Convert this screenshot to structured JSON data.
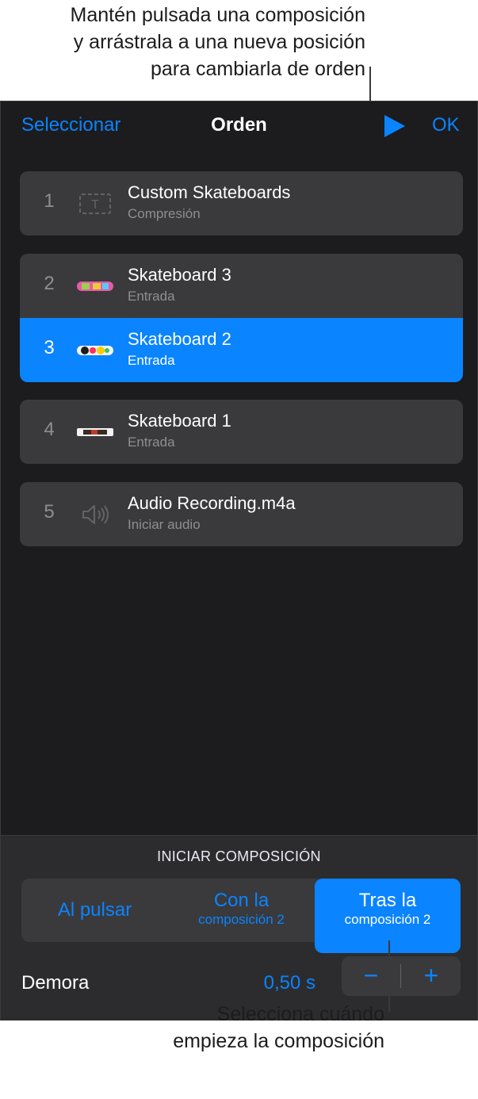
{
  "callouts": {
    "top": "Mantén pulsada una composición\ny arrástrala a una nueva posición\npara cambiarla de orden",
    "bottom": "Selecciona cuándo\nempieza la composición"
  },
  "nav": {
    "left": "Seleccionar",
    "title": "Orden",
    "right": "OK",
    "play_icon": "play-icon"
  },
  "builds": [
    {
      "num": "1",
      "title": "Custom Skateboards",
      "subtitle": "Compresión",
      "icon": "text-box-icon",
      "selected": false
    },
    {
      "num": "2",
      "title": "Skateboard 3",
      "subtitle": "Entrada",
      "icon": "skateboard-3-thumbnail",
      "selected": false
    },
    {
      "num": "3",
      "title": "Skateboard 2",
      "subtitle": "Entrada",
      "icon": "skateboard-2-thumbnail",
      "selected": true
    },
    {
      "num": "4",
      "title": "Skateboard 1",
      "subtitle": "Entrada",
      "icon": "skateboard-1-thumbnail",
      "selected": false
    },
    {
      "num": "5",
      "title": "Audio Recording.m4a",
      "subtitle": "Iniciar audio",
      "icon": "speaker-icon",
      "selected": false
    }
  ],
  "footer": {
    "heading": "INICIAR COMPOSICIÓN",
    "segments": [
      {
        "line1": "Al pulsar",
        "line2": ""
      },
      {
        "line1": "Con la",
        "line2": "composición 2"
      },
      {
        "line1": "Tras la",
        "line2": "composición 2"
      }
    ],
    "selected_segment": 2,
    "delay_label": "Demora",
    "delay_value": "0,50 s",
    "minus": "−",
    "plus": "+"
  },
  "colors": {
    "accent": "#0a84ff",
    "panel": "#1c1c1e",
    "row": "#3a3a3c"
  }
}
